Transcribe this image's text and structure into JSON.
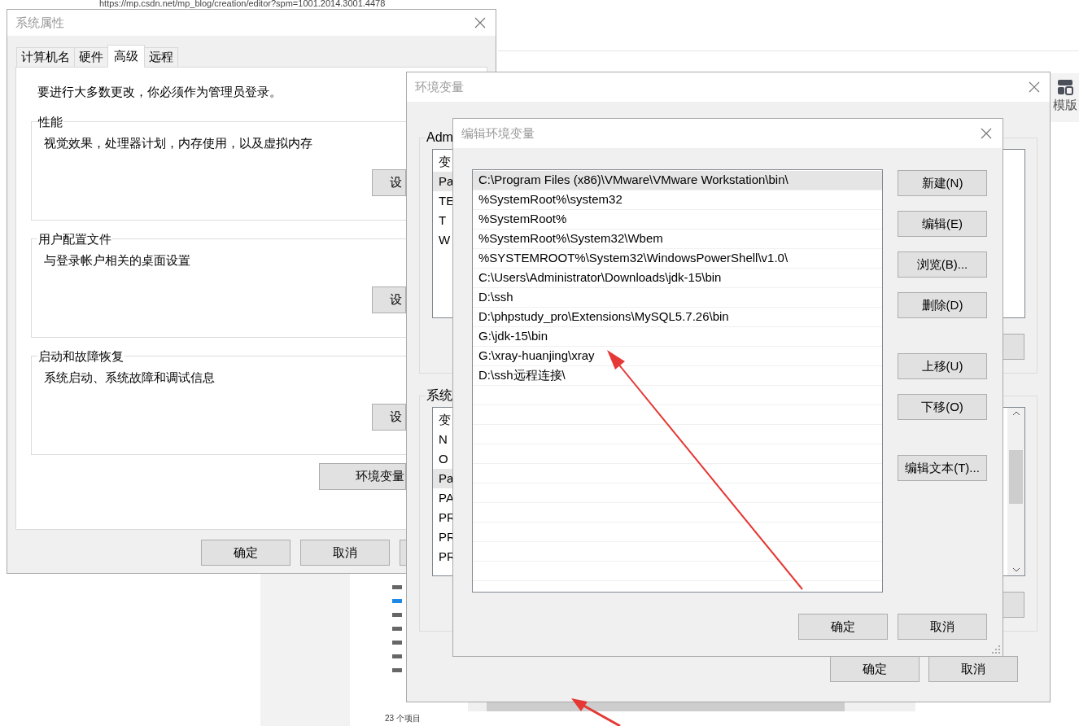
{
  "browser": {
    "url": "https://mp.csdn.net/mp_blog/creation/editor?spm=1001.2014.3001.4478",
    "side_button": "模版",
    "status": "23 个项目"
  },
  "system_properties": {
    "title": "系统属性",
    "tabs": [
      {
        "label": "计算机名",
        "selected": false
      },
      {
        "label": "硬件",
        "selected": false
      },
      {
        "label": "高级",
        "selected": true
      },
      {
        "label": "远程",
        "selected": false
      }
    ],
    "notice": "要进行大多数更改，你必须作为管理员登录。",
    "groups": [
      {
        "title": "性能",
        "description": "视觉效果，处理器计划，内存使用，以及虚拟内存",
        "button": "设"
      },
      {
        "title": "用户配置文件",
        "description": "与登录帐户相关的桌面设置",
        "button": "设"
      },
      {
        "title": "启动和故障恢复",
        "description": "系统启动、系统故障和调试信息",
        "button": "设"
      }
    ],
    "env_button": "环境变量",
    "buttons": [
      "确定",
      "取消"
    ]
  },
  "environment_variables": {
    "title": "环境变量",
    "user_group": {
      "title": "Adm",
      "header": "变",
      "rows": [
        {
          "name": "Pa",
          "selected": true
        },
        {
          "name": "TE",
          "selected": false
        },
        {
          "name": "T",
          "selected": false
        },
        {
          "name": "W",
          "selected": false
        }
      ]
    },
    "system_group": {
      "title": "系统",
      "header": "变",
      "rows": [
        {
          "name": "N",
          "selected": false
        },
        {
          "name": "O",
          "selected": false
        },
        {
          "name": "Pa",
          "selected": true
        },
        {
          "name": "PA",
          "selected": false
        },
        {
          "name": "PR",
          "selected": false
        },
        {
          "name": "PR",
          "selected": false
        },
        {
          "name": "PR",
          "selected": false
        }
      ]
    },
    "buttons": [
      "确定",
      "取消"
    ]
  },
  "edit_variable": {
    "title": "编辑环境变量",
    "paths": [
      {
        "text": "C:\\Program Files (x86)\\VMware\\VMware Workstation\\bin\\",
        "selected": true
      },
      {
        "text": "%SystemRoot%\\system32",
        "selected": false
      },
      {
        "text": "%SystemRoot%",
        "selected": false
      },
      {
        "text": "%SystemRoot%\\System32\\Wbem",
        "selected": false
      },
      {
        "text": "%SYSTEMROOT%\\System32\\WindowsPowerShell\\v1.0\\",
        "selected": false
      },
      {
        "text": "C:\\Users\\Administrator\\Downloads\\jdk-15\\bin",
        "selected": false
      },
      {
        "text": "D:\\ssh",
        "selected": false
      },
      {
        "text": "D:\\phpstudy_pro\\Extensions\\MySQL5.7.26\\bin",
        "selected": false
      },
      {
        "text": "G:\\jdk-15\\bin",
        "selected": false
      },
      {
        "text": "G:\\xray-huanjing\\xray",
        "selected": false
      },
      {
        "text": "D:\\ssh远程连接\\",
        "selected": false
      }
    ],
    "actions": [
      {
        "label": "新建(N)",
        "kind": "button"
      },
      {
        "label": "编辑(E)",
        "kind": "button"
      },
      {
        "label": "浏览(B)...",
        "kind": "button"
      },
      {
        "label": "删除(D)",
        "kind": "button"
      },
      {
        "label": "上移(U)",
        "kind": "spaced"
      },
      {
        "label": "下移(O)",
        "kind": "button"
      },
      {
        "label": "编辑文本(T)...",
        "kind": "spaced"
      }
    ],
    "buttons": [
      "确定",
      "取消"
    ]
  }
}
